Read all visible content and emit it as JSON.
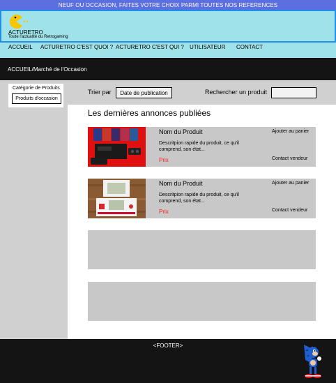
{
  "banner": {
    "text": "NEUF OU OCCASION, FAITES VOTRE CHOIX PARMI TOUTES NOS REFERENCES"
  },
  "header": {
    "site_name": "ACTURETRO",
    "tagline": "Toute l'actualité du Retrogaming"
  },
  "nav": {
    "items": [
      {
        "label": "ACCUEIL"
      },
      {
        "label": "ACTURETRO C'EST QUOI ?"
      },
      {
        "label": "ACTURETRO C'EST QUI ?"
      },
      {
        "label": "UTILISATEUR"
      },
      {
        "label": "CONTACT"
      }
    ]
  },
  "breadcrumb": {
    "text": "ACCUEIL/Marché de l'Occasion"
  },
  "sidebar": {
    "title": "Catégorie de Produits",
    "items": [
      {
        "label": "Produits d'occasion"
      }
    ]
  },
  "filters": {
    "sort_label": "Trier par",
    "sort_value": "Date de publication",
    "search_label": "Rechercher un produit",
    "search_value": ""
  },
  "listing": {
    "title": "Les dernières annonces publiées",
    "cards": [
      {
        "name": "Nom du Produit",
        "description": "Descritpion rapide du produit, ce qu'il comprend, son état...",
        "price": "Prix",
        "add_to_cart": "Ajouter au panier",
        "contact": "Contact vendeur"
      },
      {
        "name": "Nom du Produit",
        "description": "Descritpion rapide du produit, ce qu'il comprend, son état...",
        "price": "Prix",
        "add_to_cart": "Ajouter au panier",
        "contact": "Contact vendeur"
      }
    ]
  },
  "footer": {
    "text": "<FOOTER>"
  },
  "colors": {
    "banner": "#5b6fe0",
    "header_bg": "#a0e2ea",
    "header_border": "#1f8fe8",
    "dark_bar": "#141414",
    "panel_gray": "#d0d0d0",
    "card_gray": "#c8c8c8",
    "price_red": "#ff1a1a"
  },
  "icons": {
    "logo": "pacman-logo-icon",
    "mascot": "sonic-mascot-icon",
    "product_1": "console-games-photo",
    "product_2": "game-and-watch-photo"
  }
}
